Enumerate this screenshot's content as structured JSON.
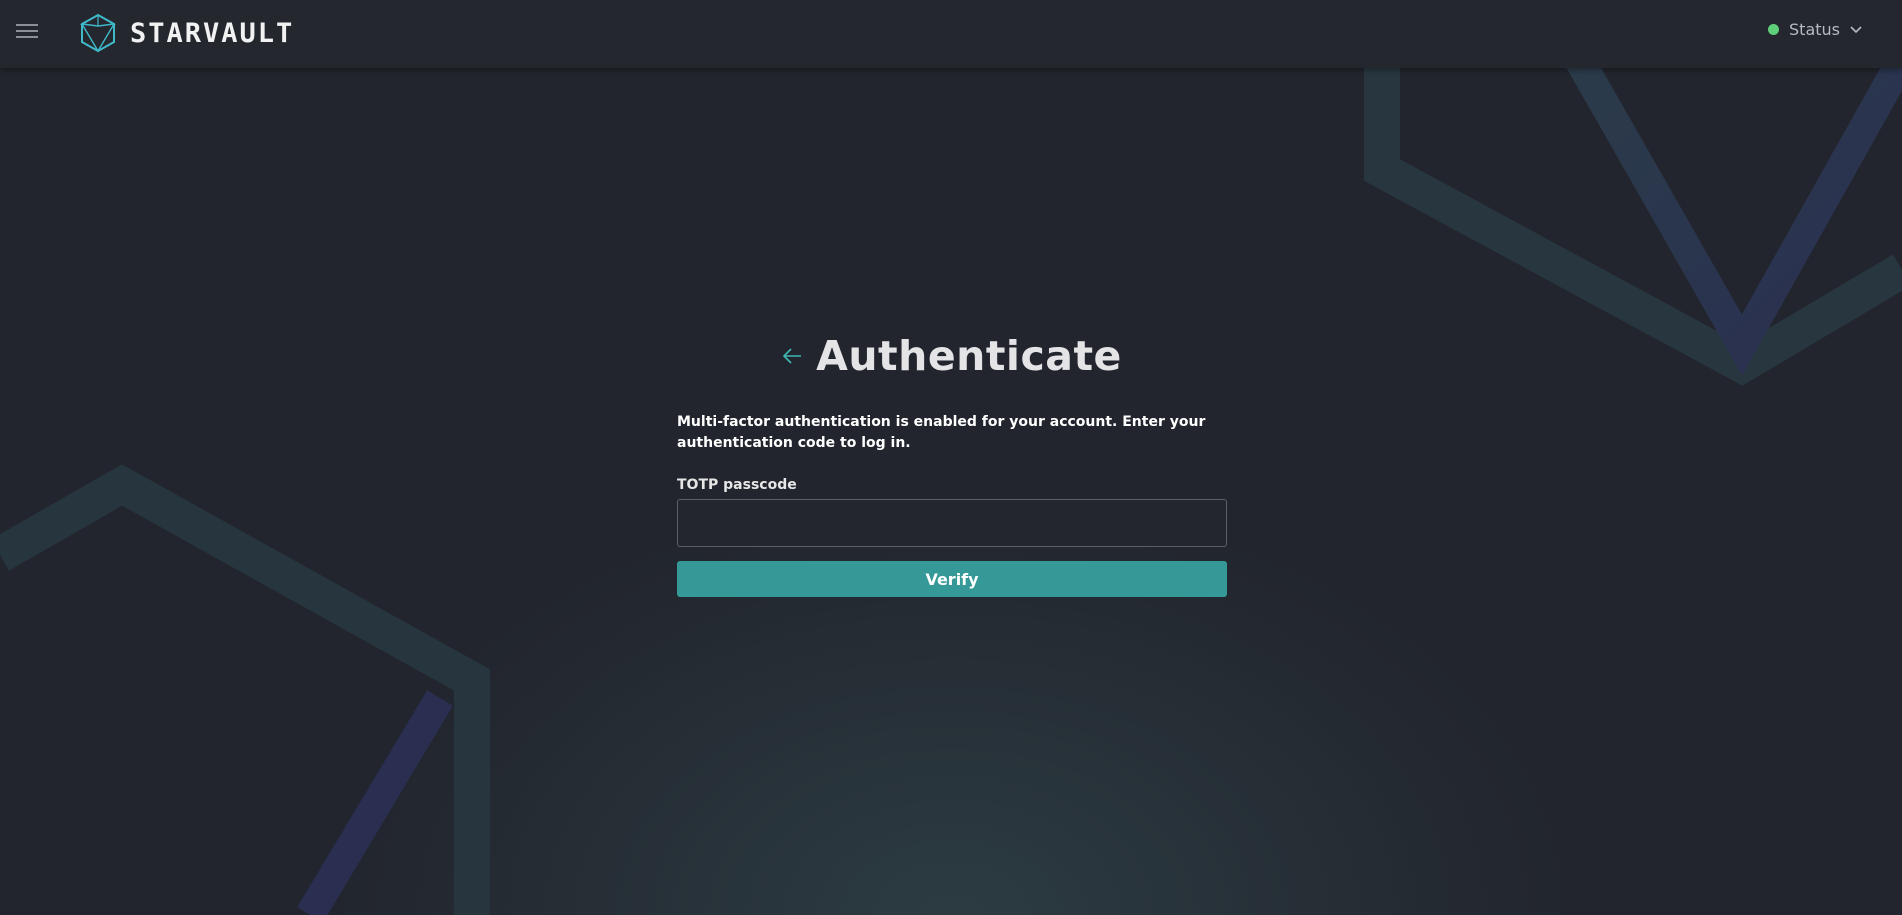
{
  "header": {
    "brand": "STARVAULT",
    "status_label": "Status",
    "status_color": "#5ecf7a",
    "icons": {
      "menu": "hamburger-menu-icon",
      "logo": "icosahedron-logo-icon",
      "status_dropdown": "chevron-down-icon"
    }
  },
  "auth": {
    "title": "Authenticate",
    "back_icon": "arrow-left-icon",
    "description": "Multi-factor authentication is enabled for your account. Enter your authentication code to log in.",
    "field_label": "TOTP passcode",
    "field_value": "",
    "field_placeholder": "",
    "submit_label": "Verify"
  },
  "colors": {
    "accent": "#359a97",
    "background": "#22252d",
    "header": "#24272e",
    "arrow": "#3fb9b5"
  }
}
